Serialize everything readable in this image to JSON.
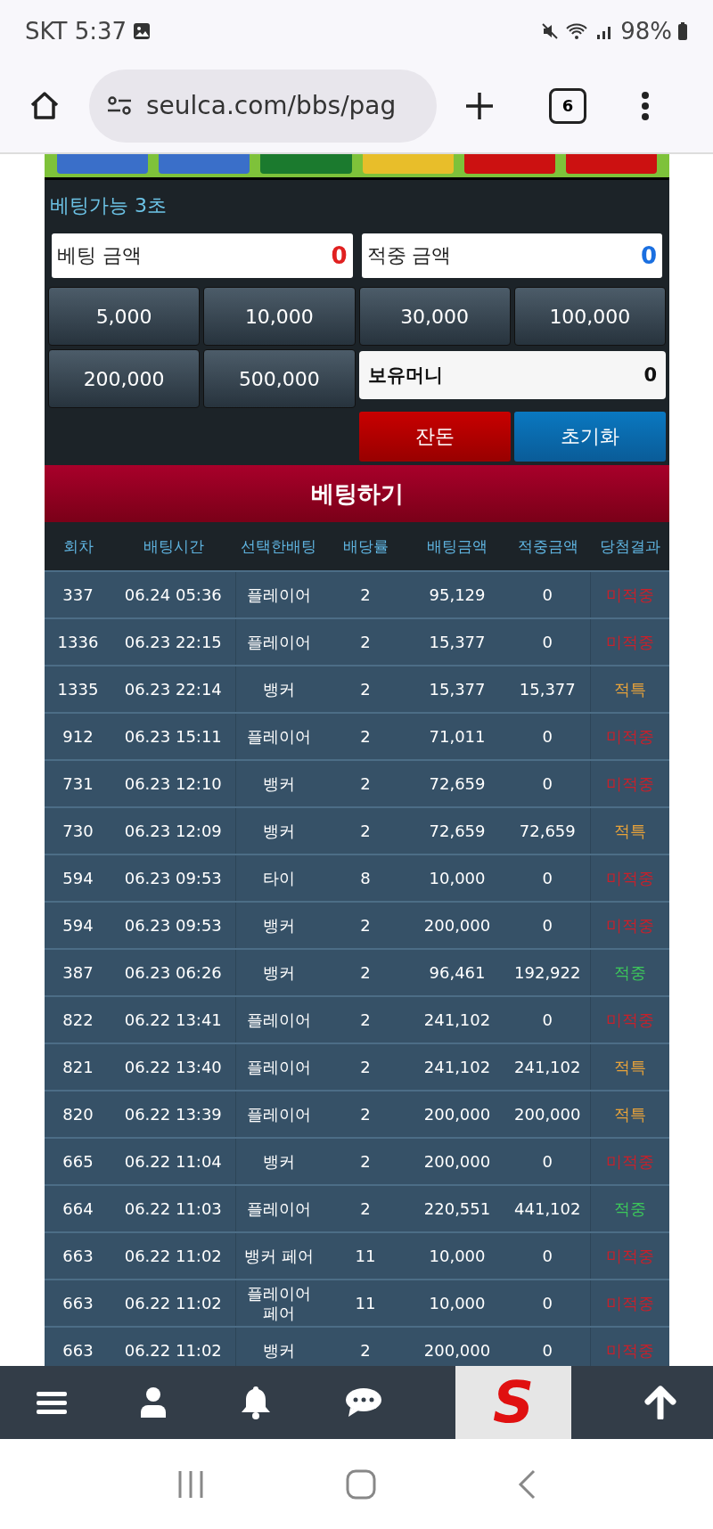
{
  "status_bar": {
    "carrier_time": "SKT 5:37",
    "battery": "98%"
  },
  "browser": {
    "url": "seulca.com/bbs/pag",
    "tab_count": "6"
  },
  "odds_strip": [
    {
      "color": "#3a6fc9"
    },
    {
      "color": "#3a6fc9"
    },
    {
      "color": "#1b7a2e"
    },
    {
      "color": "#e8be2a"
    },
    {
      "color": "#cc1111"
    },
    {
      "color": "#cc1111"
    }
  ],
  "betting_status": "베팅가능 3초",
  "bet_amount": {
    "label": "베팅 금액",
    "value": "0"
  },
  "win_amount": {
    "label": "적중 금액",
    "value": "0"
  },
  "chips": [
    "5,000",
    "10,000",
    "30,000",
    "100,000",
    "200,000",
    "500,000"
  ],
  "balance": {
    "label": "보유머니",
    "value": "0"
  },
  "change_button": "잔돈",
  "reset_button": "초기화",
  "bet_button": "베팅하기",
  "table": {
    "columns": [
      "회차",
      "배팅시간",
      "선택한배팅",
      "배당률",
      "배팅금액",
      "적중금액",
      "당첨결과"
    ],
    "rows": [
      {
        "cells": [
          "337",
          "06.24 05:36",
          "플레이어",
          "2",
          "95,129",
          "0"
        ],
        "result": "미적중",
        "color": "#c8202a"
      },
      {
        "cells": [
          "1336",
          "06.23 22:15",
          "플레이어",
          "2",
          "15,377",
          "0"
        ],
        "result": "미적중",
        "color": "#c8202a"
      },
      {
        "cells": [
          "1335",
          "06.23 22:14",
          "뱅커",
          "2",
          "15,377",
          "15,377"
        ],
        "result": "적특",
        "color": "#e8a33a"
      },
      {
        "cells": [
          "912",
          "06.23 15:11",
          "플레이어",
          "2",
          "71,011",
          "0"
        ],
        "result": "미적중",
        "color": "#c8202a"
      },
      {
        "cells": [
          "731",
          "06.23 12:10",
          "뱅커",
          "2",
          "72,659",
          "0"
        ],
        "result": "미적중",
        "color": "#c8202a"
      },
      {
        "cells": [
          "730",
          "06.23 12:09",
          "뱅커",
          "2",
          "72,659",
          "72,659"
        ],
        "result": "적특",
        "color": "#e8a33a"
      },
      {
        "cells": [
          "594",
          "06.23 09:53",
          "타이",
          "8",
          "10,000",
          "0"
        ],
        "result": "미적중",
        "color": "#c8202a"
      },
      {
        "cells": [
          "594",
          "06.23 09:53",
          "뱅커",
          "2",
          "200,000",
          "0"
        ],
        "result": "미적중",
        "color": "#c8202a"
      },
      {
        "cells": [
          "387",
          "06.23 06:26",
          "뱅커",
          "2",
          "96,461",
          "192,922"
        ],
        "result": "적중",
        "color": "#3cc85a"
      },
      {
        "cells": [
          "822",
          "06.22 13:41",
          "플레이어",
          "2",
          "241,102",
          "0"
        ],
        "result": "미적중",
        "color": "#c8202a"
      },
      {
        "cells": [
          "821",
          "06.22 13:40",
          "플레이어",
          "2",
          "241,102",
          "241,102"
        ],
        "result": "적특",
        "color": "#e8a33a"
      },
      {
        "cells": [
          "820",
          "06.22 13:39",
          "플레이어",
          "2",
          "200,000",
          "200,000"
        ],
        "result": "적특",
        "color": "#e8a33a"
      },
      {
        "cells": [
          "665",
          "06.22 11:04",
          "뱅커",
          "2",
          "200,000",
          "0"
        ],
        "result": "미적중",
        "color": "#c8202a"
      },
      {
        "cells": [
          "664",
          "06.22 11:03",
          "플레이어",
          "2",
          "220,551",
          "441,102"
        ],
        "result": "적중",
        "color": "#3cc85a"
      },
      {
        "cells": [
          "663",
          "06.22 11:02",
          "뱅커 페어",
          "11",
          "10,000",
          "0"
        ],
        "result": "미적중",
        "color": "#c8202a"
      },
      {
        "cells": [
          "663",
          "06.22 11:02",
          "플레이어 페어",
          "11",
          "10,000",
          "0"
        ],
        "result": "미적중",
        "color": "#c8202a"
      },
      {
        "cells": [
          "663",
          "06.22 11:02",
          "뱅커",
          "2",
          "200,000",
          "0"
        ],
        "result": "미적중",
        "color": "#c8202a"
      }
    ]
  },
  "bottom_nav": {
    "logo": "S"
  }
}
